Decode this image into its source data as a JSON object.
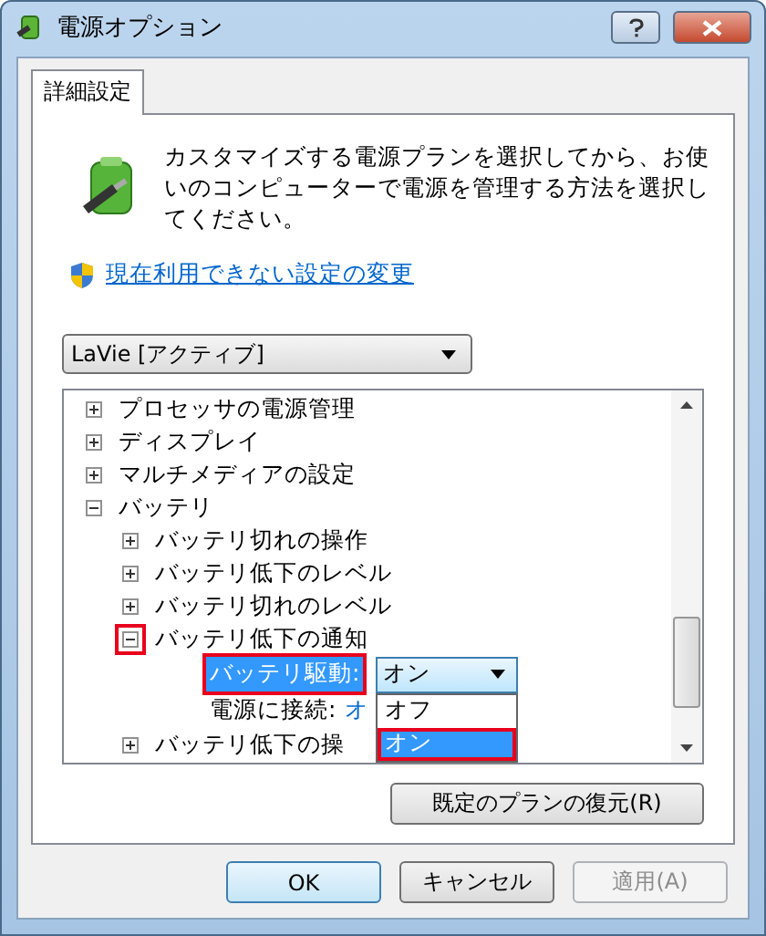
{
  "window": {
    "title": "電源オプション"
  },
  "tabs": [
    {
      "label": "詳細設定",
      "selected": true
    }
  ],
  "intro": "カスタマイズする電源プランを選択してから、お使いのコンピューターで電源を管理する方法を選択してください。",
  "link": "現在利用できない設定の変更",
  "plan_select": {
    "value": "LaVie [アクティブ]"
  },
  "tree": [
    {
      "kind": "group",
      "label": "プロセッサの電源管理",
      "expanded": false,
      "highlighted": false
    },
    {
      "kind": "group",
      "label": "ディスプレイ",
      "expanded": false,
      "highlighted": false
    },
    {
      "kind": "group",
      "label": "マルチメディアの設定",
      "expanded": false,
      "highlighted": false
    },
    {
      "kind": "group",
      "label": "バッテリ",
      "expanded": true,
      "highlighted": false,
      "children": [
        {
          "kind": "group",
          "label": "バッテリ切れの操作",
          "expanded": false,
          "highlighted": false
        },
        {
          "kind": "group",
          "label": "バッテリ低下のレベル",
          "expanded": false,
          "highlighted": false
        },
        {
          "kind": "group",
          "label": "バッテリ切れのレベル",
          "expanded": false,
          "highlighted": false
        },
        {
          "kind": "group",
          "label": "バッテリ低下の通知",
          "expanded": true,
          "highlighted": true,
          "children": [
            {
              "kind": "setting",
              "label": "バッテリ駆動:",
              "value": "オン",
              "selected": true,
              "highlighted": true,
              "options": [
                {
                  "label": "オフ",
                  "selected": false,
                  "highlighted": false
                },
                {
                  "label": "オン",
                  "selected": true,
                  "highlighted": true
                }
              ]
            },
            {
              "kind": "setting",
              "label": "電源に接続:",
              "value": "オ",
              "selected": false,
              "highlighted": false
            }
          ]
        },
        {
          "kind": "group",
          "label": "バッテリ低下の操",
          "expanded": false,
          "highlighted": false
        }
      ]
    }
  ],
  "restore_button": "既定のプランの復元(R)",
  "buttons": [
    {
      "label": "OK",
      "disabled": false,
      "default": true
    },
    {
      "label": "キャンセル",
      "disabled": false,
      "default": false
    },
    {
      "label": "適用(A)",
      "disabled": true,
      "default": false
    }
  ]
}
